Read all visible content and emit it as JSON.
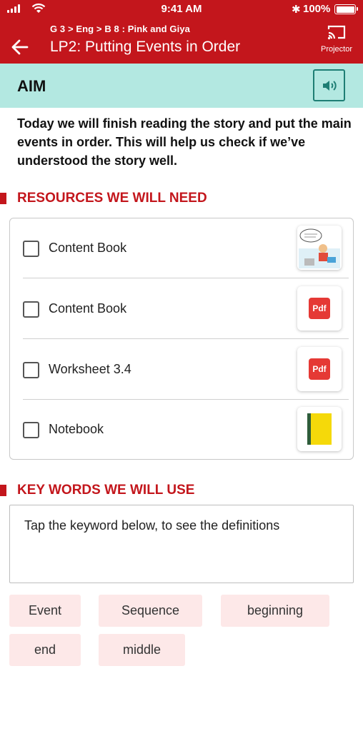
{
  "status_bar": {
    "time": "9:41 AM",
    "battery": "100%"
  },
  "header": {
    "breadcrumb": "G 3 > Eng > B 8 : Pink and Giya",
    "title": "LP2: Putting Events in Order",
    "projector_label": "Projector",
    "back_icon": "arrow-left-icon",
    "projector_icon": "cast-icon"
  },
  "aim": {
    "heading": "AIM",
    "text": "Today we will finish reading the story and put the main events in order. This will help us check if we’ve understood the story well.",
    "speaker_icon": "speaker-icon"
  },
  "resources": {
    "heading": "RESOURCES WE WILL NEED",
    "items": [
      {
        "label": "Content Book",
        "thumb": "comic-thumbnail"
      },
      {
        "label": "Content Book",
        "thumb": "pdf-icon",
        "thumb_text": "Pdf"
      },
      {
        "label": "Worksheet 3.4",
        "thumb": "pdf-icon",
        "thumb_text": "Pdf"
      },
      {
        "label": "Notebook",
        "thumb": "notebook-icon"
      }
    ]
  },
  "keywords": {
    "heading": "KEY WORDS WE WILL USE",
    "hint": "Tap the keyword below, to see the definitions",
    "chips": [
      "Event",
      "Sequence",
      "beginning",
      "end",
      "middle"
    ]
  },
  "colors": {
    "brand": "#c3161c",
    "aim_band": "#b3e8e1",
    "chip_bg": "#fde8e8"
  }
}
